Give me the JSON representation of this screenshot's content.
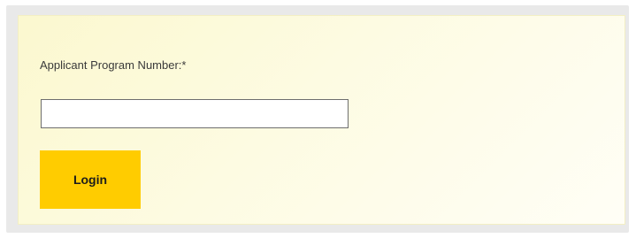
{
  "form": {
    "label": "Applicant Program Number:*",
    "input_value": "",
    "input_placeholder": "",
    "login_label": "Login"
  },
  "colors": {
    "button_bg": "#ffcc00",
    "panel_bg": "#fdfbe2",
    "outer_bg": "#e9e9e9"
  }
}
